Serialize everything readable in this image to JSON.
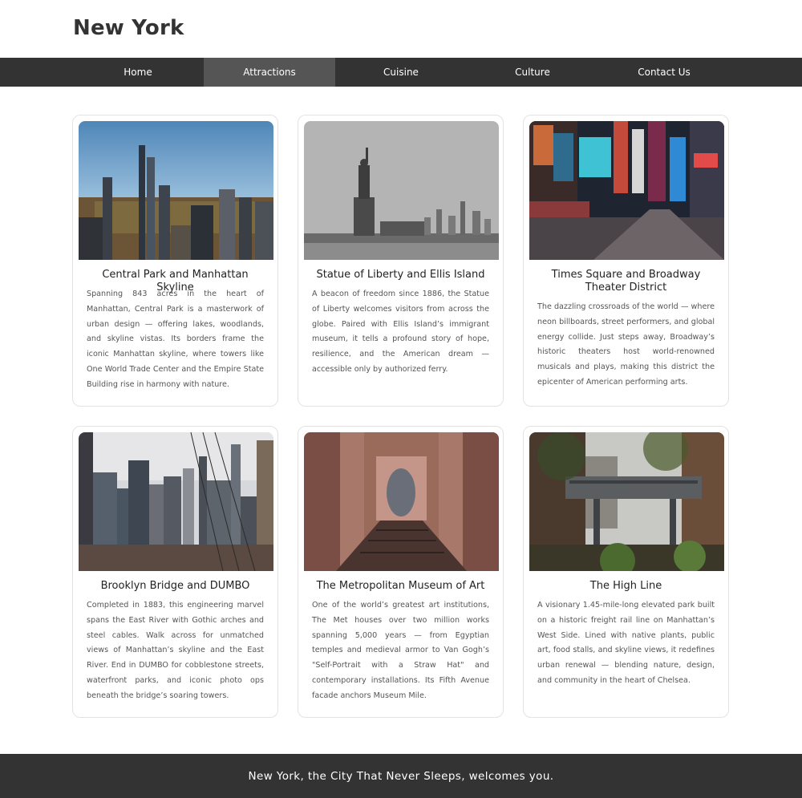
{
  "header": {
    "title": "New York"
  },
  "nav": {
    "items": [
      {
        "label": "Home"
      },
      {
        "label": "Attractions"
      },
      {
        "label": "Cuisine"
      },
      {
        "label": "Culture"
      },
      {
        "label": "Contact Us"
      }
    ],
    "active": "Attractions"
  },
  "cards": [
    {
      "title": "Central Park and Manhattan Skyline",
      "description": "Spanning 843 acres in the heart of Manhattan, Central Park is a masterwork of urban design — offering lakes, woodlands, and skyline vistas. Its borders frame the iconic Manhattan skyline, where towers like One World Trade Center and the Empire State Building rise in harmony with nature."
    },
    {
      "title": "Statue of Liberty and Ellis Island",
      "description": "A beacon of freedom since 1886, the Statue of Liberty welcomes visitors from across the globe. Paired with Ellis Island’s immigrant museum, it tells a profound story of hope, resilience, and the American dream — accessible only by authorized ferry."
    },
    {
      "title": "Times Square and Broadway Theater District",
      "description": "The dazzling crossroads of the world — where neon billboards, street performers, and global energy collide. Just steps away, Broadway’s historic theaters host world-renowned musicals and plays, making this district the epicenter of American performing arts."
    },
    {
      "title": "Brooklyn Bridge and DUMBO",
      "description": "Completed in 1883, this engineering marvel spans the East River with Gothic arches and steel cables. Walk across for unmatched views of Manhattan’s skyline and the East River. End in DUMBO for cobblestone streets, waterfront parks, and iconic photo ops beneath the bridge’s soaring towers."
    },
    {
      "title": "The Metropolitan Museum of Art",
      "description": "One of the world’s greatest art institutions, The Met houses over two million works spanning 5,000 years — from Egyptian temples and medieval armor to Van Gogh’s \"Self-Portrait with a Straw Hat\" and contemporary installations. Its Fifth Avenue facade anchors Museum Mile."
    },
    {
      "title": "The High Line",
      "description": "A visionary 1.45-mile-long elevated park built on a historic freight rail line on Manhattan’s West Side. Lined with native plants, public art, food stalls, and skyline views, it redefines urban renewal — blending nature, design, and community in the heart of Chelsea."
    }
  ],
  "footer": {
    "text": "New York, the City That Never Sleeps, welcomes you."
  },
  "colors": {
    "nav_bg": "#333333",
    "nav_active_bg": "#555555",
    "footer_bg": "#333333",
    "card_border": "#e3e3e3"
  }
}
